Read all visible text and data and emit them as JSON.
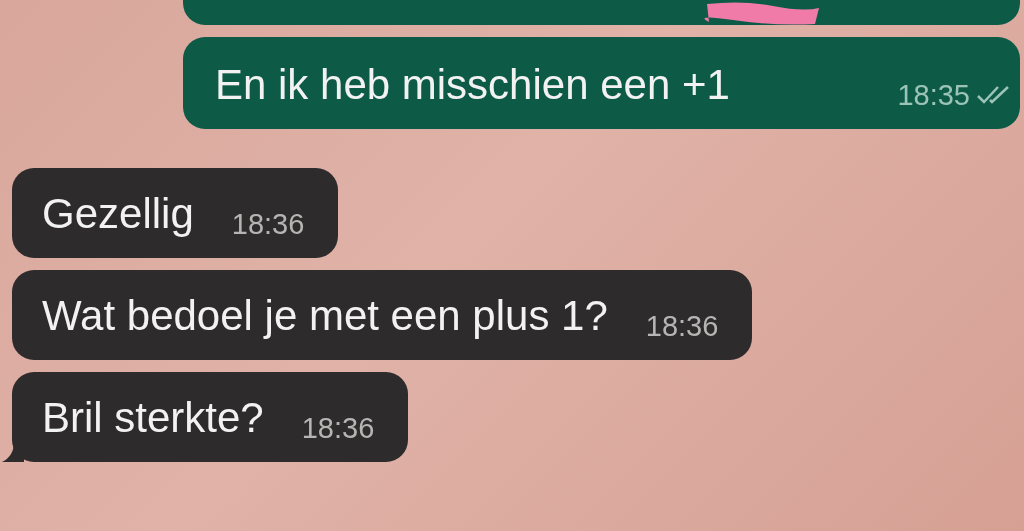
{
  "messages": [
    {
      "kind": "outgoing-cut",
      "redacted": true
    },
    {
      "kind": "outgoing",
      "text": "En ik heb misschien een +1",
      "time": "18:35",
      "delivered": true
    },
    {
      "kind": "incoming",
      "text": "Gezellig",
      "time": "18:36",
      "tail": false
    },
    {
      "kind": "incoming",
      "text": "Wat bedoel je met een plus 1?",
      "time": "18:36",
      "tail": false
    },
    {
      "kind": "incoming",
      "text": "Bril sterkte?",
      "time": "18:36",
      "tail": true
    }
  ]
}
